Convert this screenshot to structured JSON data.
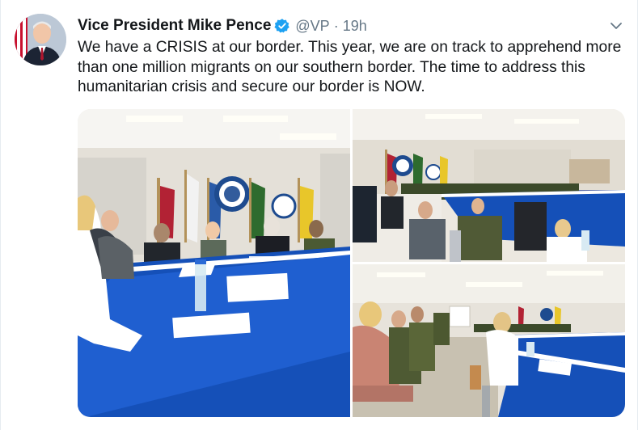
{
  "tweet": {
    "author_name": "Vice President Mike Pence",
    "handle": "@VP",
    "separator": "·",
    "time": "19h",
    "text": "We have a CRISIS at our border. This year, we are on track to apprehend more than one million migrants on our southern border. The time to address this humanitarian crisis and secure our border is NOW."
  },
  "media": {
    "photos": [
      {
        "icon": "photo-roundtable-meeting"
      },
      {
        "icon": "photo-roundtable-wide"
      },
      {
        "icon": "photo-roundtable-side"
      }
    ]
  },
  "colors": {
    "verified": "#1da1f2",
    "table_blue": "#1550b8",
    "text_primary": "#14171a",
    "text_secondary": "#657786"
  }
}
